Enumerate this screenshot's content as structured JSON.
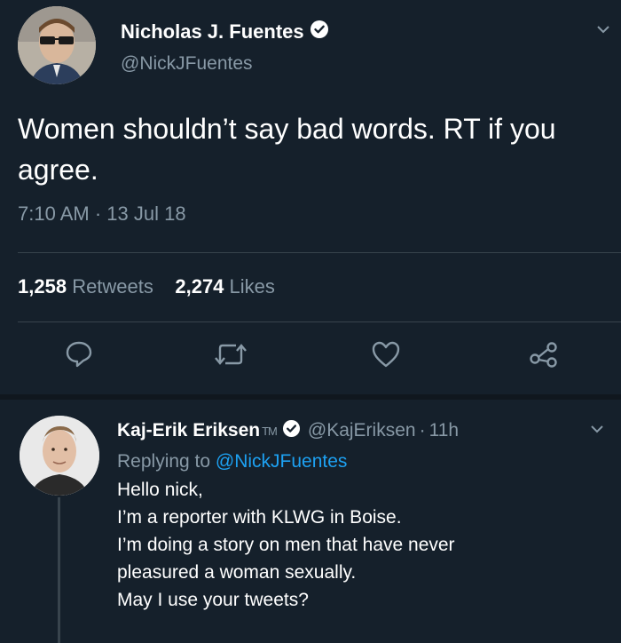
{
  "tweet": {
    "author_name": "Nicholas J. Fuentes",
    "author_handle": "@NickJFuentes",
    "text": "Women shouldn’t say bad words. RT if you agree.",
    "time": "7:10 AM",
    "date": "13 Jul 18",
    "retweets_count": "1,258",
    "retweets_label": "Retweets",
    "likes_count": "2,274",
    "likes_label": "Likes"
  },
  "reply": {
    "author_name": "Kaj-Erik Eriksen",
    "tm": "TM",
    "author_handle": "@KajEriksen",
    "age": "11h",
    "replying_prefix": "Replying to",
    "replying_to": "@NickJFuentes",
    "lines": [
      "Hello nick,",
      "I’m a reporter with KLWG in Boise.",
      "I’m doing a story on men that have never",
      "pleasured a woman sexually.",
      "May I use your tweets?"
    ]
  },
  "icons": {
    "verified": "verified-badge-icon",
    "chevron": "chevron-down-icon",
    "reply": "reply-icon",
    "retweet": "retweet-icon",
    "like": "heart-icon",
    "share": "share-icon"
  },
  "colors": {
    "background": "#15202b",
    "secondary_text": "#8899a6",
    "link": "#1da1f2",
    "divider": "#38444d"
  }
}
